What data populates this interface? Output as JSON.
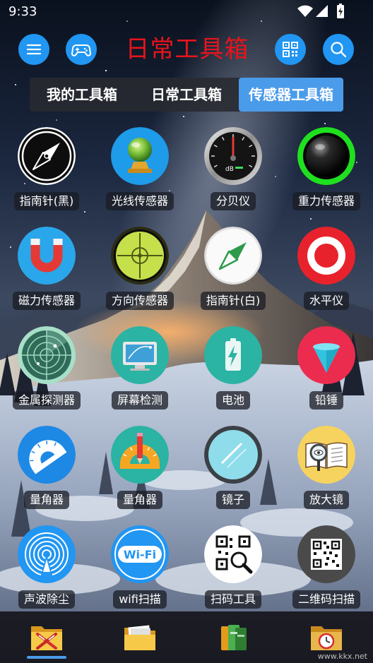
{
  "status_bar": {
    "time": "9:33",
    "icons": [
      "wifi-icon",
      "signal-icon",
      "battery-charging-icon"
    ]
  },
  "header": {
    "title": "日常工具箱",
    "title_color": "#E8141B",
    "button_color": "#2196F3",
    "left_buttons": [
      "menu-icon",
      "gamepad-icon"
    ],
    "right_buttons": [
      "qr-code-icon",
      "search-icon"
    ]
  },
  "tabs": [
    {
      "label": "我的工具箱",
      "active": false
    },
    {
      "label": "日常工具箱",
      "active": false
    },
    {
      "label": "传感器工具箱",
      "active": true
    }
  ],
  "active_tab_color": "#4A9BEA",
  "tools": [
    {
      "label": "指南针(黑)",
      "icon": "compass-black-icon"
    },
    {
      "label": "光线传感器",
      "icon": "light-sensor-icon"
    },
    {
      "label": "分贝仪",
      "icon": "decibel-meter-icon"
    },
    {
      "label": "重力传感器",
      "icon": "gravity-ball-icon"
    },
    {
      "label": "磁力传感器",
      "icon": "magnet-icon"
    },
    {
      "label": "方向传感器",
      "icon": "direction-crosshair-icon"
    },
    {
      "label": "指南针(白)",
      "icon": "compass-white-icon"
    },
    {
      "label": "水平仪",
      "icon": "level-target-icon"
    },
    {
      "label": "金属探测器",
      "icon": "radar-icon"
    },
    {
      "label": "屏幕检测",
      "icon": "monitor-icon"
    },
    {
      "label": "电池",
      "icon": "battery-icon"
    },
    {
      "label": "铅锤",
      "icon": "plumb-cone-icon"
    },
    {
      "label": "量角器",
      "icon": "protractor-icon"
    },
    {
      "label": "量角器",
      "icon": "protractor-pencil-icon"
    },
    {
      "label": "镜子",
      "icon": "mirror-icon"
    },
    {
      "label": "放大镜",
      "icon": "magnifier-book-icon"
    },
    {
      "label": "声波除尘",
      "icon": "sound-wave-icon"
    },
    {
      "label": "wifi扫描",
      "icon": "wifi-badge-icon"
    },
    {
      "label": "扫码工具",
      "icon": "qr-magnifier-icon"
    },
    {
      "label": "二维码扫描",
      "icon": "qr-code-icon"
    }
  ],
  "icon_text": {
    "decibel": "dB",
    "wifi": "Wi-Fi"
  },
  "bottom_nav": [
    {
      "icon": "tools-folder-icon",
      "active": true
    },
    {
      "icon": "documents-folder-icon",
      "active": false
    },
    {
      "icon": "books-folder-icon",
      "active": false
    },
    {
      "icon": "clock-folder-icon",
      "active": false
    }
  ],
  "watermark": "www.kkx.net"
}
